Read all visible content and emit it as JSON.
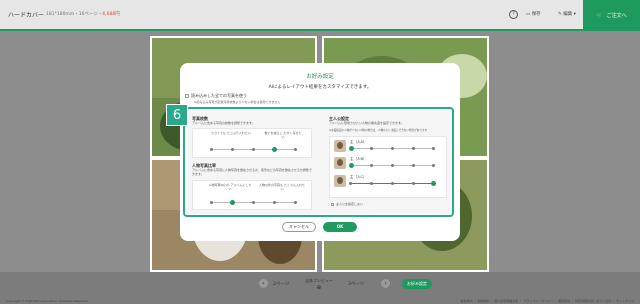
{
  "header": {
    "product_name": "ハードカバー",
    "spec_text": "181*180mm・16ページ・",
    "price": "6,688円",
    "help_label": "?",
    "save_label": "保存",
    "edit_label": "編集",
    "cart_label": "ご注文へ"
  },
  "dialog": {
    "title": "お好み設定",
    "subtitle": "AIによるレイアウト結果をカスタマイズできます。",
    "use_all_label": "読み込みした全ての写真を使う",
    "use_all_note": "※読み込み写真が配置可能枚数より少ない場合は使用できません",
    "step_number": "6",
    "photo_count": {
      "heading": "写真枚数",
      "description": "アルバムに含める写真の枚数を調整できます。",
      "left_label": "小さくても たっぷり入れたい",
      "right_label": "数いを減らし 大きくみせたい",
      "steps": 5,
      "selected_index": 3
    },
    "people_ratio": {
      "heading": "人物写真比率",
      "description": "アルバムに含める写真に人物写真を優先させるか、風景などの写真を優先させるか調整できます。",
      "left_label": "人物写真中心の アルバムにしたい",
      "right_label": "人物以外の写真も たくさん入れたい",
      "steps": 5,
      "selected_index": 1
    },
    "main_character": {
      "heading": "主人公設定",
      "description": "アルバムに登場させたい人物の優先度を設定できます。",
      "note": "※主役指定の人物が少ない人物の場合は、人物以上に主役にできない場合があります",
      "people": [
        {
          "name": "主（人A）",
          "selected_index": 0
        },
        {
          "name": "主（人B）",
          "selected_index": 0
        },
        {
          "name": "主（人C）",
          "selected_index": 4
        }
      ],
      "steps": 5,
      "no_priority_label": "主人公を指定しない"
    },
    "cancel_label": "キャンセル",
    "ok_label": "OK"
  },
  "footer": {
    "prev_page_label": "2ページ",
    "next_page_label": "3ページ",
    "preview_label": "全体プレビュー",
    "order_label": "お好み設定",
    "copyright": "Copyright © FUJIFILM Corporation. All Rights Reserved.",
    "links": "会社案内 ｜ 利用規約 ｜ 個人情報保護方針 ｜ プライバシーポリシー ｜ 推奨環境 ｜ 特定商取引法に基づく表示 ｜ サイトマップ"
  }
}
